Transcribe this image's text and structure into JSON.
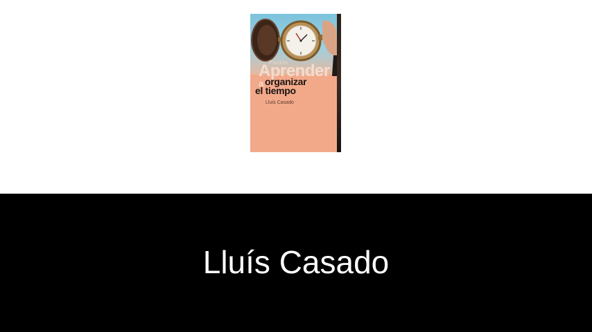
{
  "book": {
    "series_label": "Paidós",
    "title_line1": "Aprender",
    "title_connector": "a",
    "title_line2": "organizar",
    "title_line3": "el tiempo",
    "cover_author": "Lluís Casado",
    "cover_image_icon": "pocket-watch-icon"
  },
  "banner": {
    "author_name": "Lluís Casado"
  },
  "colors": {
    "cover_peach": "#f2a98a",
    "cover_sky": "#7cc3dc",
    "band_background": "#000000",
    "band_text": "#ffffff"
  }
}
